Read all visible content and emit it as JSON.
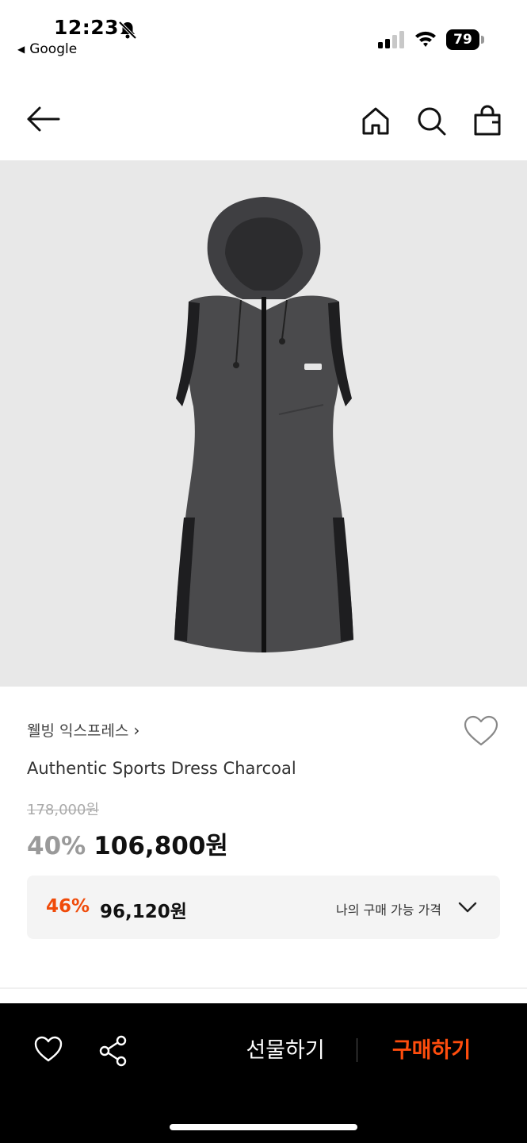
{
  "status_bar": {
    "time": "12:23",
    "back_app": "Google",
    "battery": "79"
  },
  "icons": {
    "back": "arrow-left",
    "home": "house",
    "search": "magnifier",
    "cart": "shopping-bag",
    "wish": "heart-outline",
    "share": "share-nodes",
    "chevron": "chevron-down"
  },
  "product": {
    "brand": "웰빙 익스프레스",
    "brand_chevron": "›",
    "name": "Authentic Sports Dress Charcoal",
    "original_price": "178,000원",
    "discount": "40%",
    "sale_price": "106,800원"
  },
  "my_price": {
    "discount": "46%",
    "price": "96,120원",
    "label": "나의 구매 가능 가격"
  },
  "bottom_bar": {
    "gift_label": "선물하기",
    "buy_label": "구매하기"
  },
  "colors": {
    "accent": "#f04b0a",
    "buy": "#ff4d0d",
    "image_bg": "#e8e8e8",
    "dress": "#4a4a4c"
  }
}
